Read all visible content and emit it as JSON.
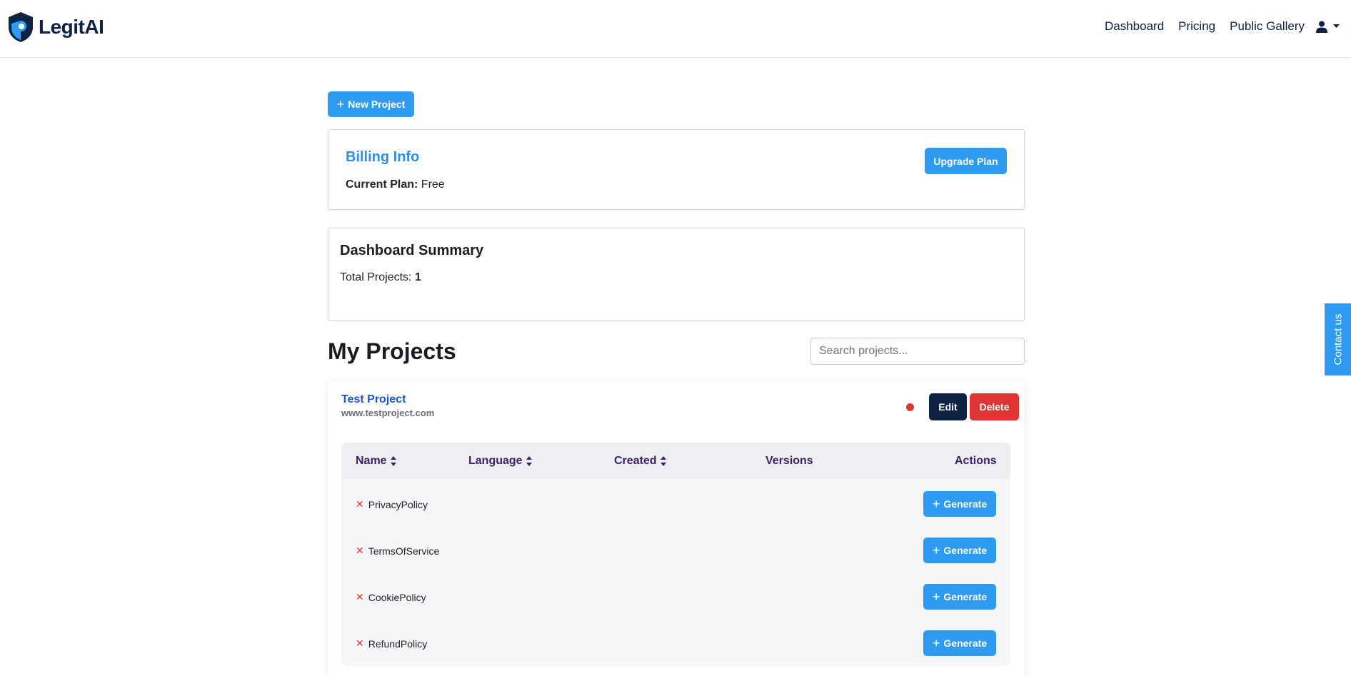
{
  "brand": {
    "name": "LegitAI"
  },
  "nav": {
    "dashboard": "Dashboard",
    "pricing": "Pricing",
    "gallery": "Public Gallery"
  },
  "actions": {
    "new_project": "New Project"
  },
  "billing": {
    "title": "Billing Info",
    "plan_label": "Current Plan:",
    "plan_value": "Free",
    "upgrade": "Upgrade Plan"
  },
  "summary": {
    "title": "Dashboard Summary",
    "total_label": "Total Projects:",
    "total_value": "1"
  },
  "projects": {
    "heading": "My Projects",
    "search_placeholder": "Search projects...",
    "items": [
      {
        "name": "Test Project",
        "url": "www.testproject.com",
        "edit": "Edit",
        "delete": "Delete",
        "status_color": "#e03535",
        "columns": {
          "name": "Name",
          "language": "Language",
          "created": "Created",
          "versions": "Versions",
          "actions": "Actions"
        },
        "policies": [
          {
            "name": "PrivacyPolicy",
            "generate": "Generate"
          },
          {
            "name": "TermsOfService",
            "generate": "Generate"
          },
          {
            "name": "CookiePolicy",
            "generate": "Generate"
          },
          {
            "name": "RefundPolicy",
            "generate": "Generate"
          }
        ]
      }
    ]
  },
  "contact": {
    "label": "Contact us"
  },
  "colors": {
    "primary": "#2f9bf0",
    "dark": "#0f2244",
    "danger": "#e03535",
    "header_text": "#3d2068"
  }
}
